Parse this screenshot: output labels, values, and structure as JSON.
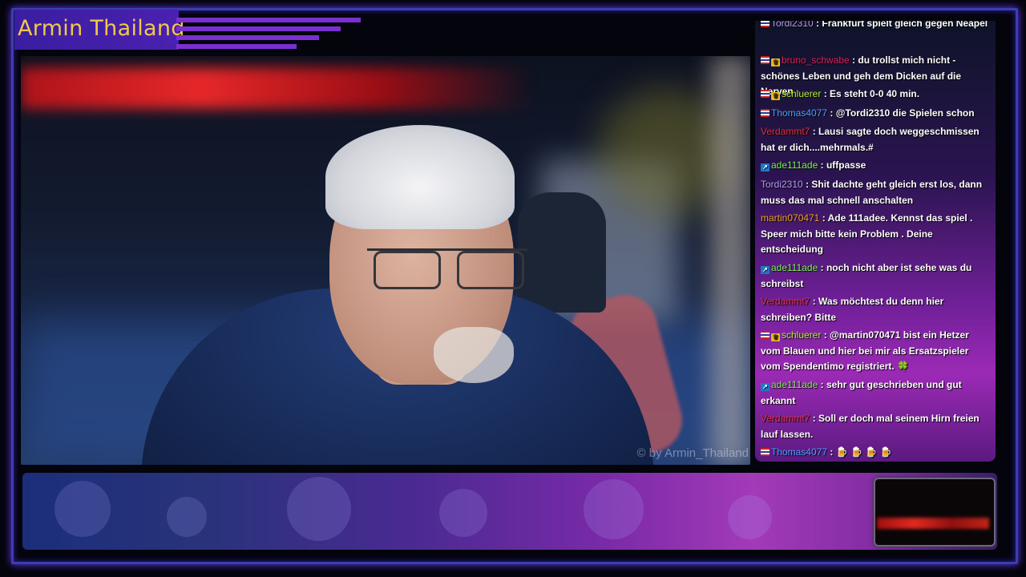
{
  "stream": {
    "title": "Armin Thailand",
    "watermark": "© by Armin_Thailand"
  },
  "chat": {
    "messages": [
      {
        "user": "Tordi2310",
        "color": "#b69cf0",
        "badges": [
          "flag"
        ],
        "text": ": Frankfurt spielt gleich gegen Neapel"
      },
      {
        "user": "bruno_schwabe",
        "color": "#e0205a",
        "badges": [
          "flag",
          "crown"
        ],
        "text": ": du trollst mich nicht - schönes Leben und geh dem Dicken auf die Nerven"
      },
      {
        "user": "schluerer",
        "color": "#b6f036",
        "badges": [
          "flag",
          "crown"
        ],
        "text": ": Es steht 0-0 40 min."
      },
      {
        "user": "Thomas4077",
        "color": "#4aa0ff",
        "badges": [
          "flag"
        ],
        "text": ": @Tordi2310 die Spielen schon"
      },
      {
        "user": "Verdammt7",
        "color": "#e0303a",
        "badges": [],
        "text": ": Lausi sagte doch weggeschmissen hat er dich....mehrmals.#"
      },
      {
        "user": "ade111ade",
        "color": "#7cf05a",
        "badges": [
          "prime"
        ],
        "text": ": uffpasse"
      },
      {
        "user": "Tordi2310",
        "color": "#b69cf0",
        "badges": [],
        "text": ": Shit dachte geht gleich erst los, dann muss das mal schnell anschalten"
      },
      {
        "user": "martin070471",
        "color": "#f0a020",
        "badges": [],
        "text": ": Ade 111adee. Kennst das spiel . Speer mich bitte kein Problem . Deine entscheidung"
      },
      {
        "user": "ade111ade",
        "color": "#7cf05a",
        "badges": [
          "prime"
        ],
        "text": ": noch nicht aber ist sehe was du schreibst"
      },
      {
        "user": "Verdammt7",
        "color": "#e0303a",
        "badges": [],
        "text": ": Was möchtest du denn hier schreiben? Bitte"
      },
      {
        "user": "schluerer",
        "color": "#b6f036",
        "badges": [
          "flag",
          "crown"
        ],
        "text": ": @martin070471 bist ein Hetzer vom Blauen und hier bei mir als Ersatzspieler vom Spendentimo registriert. 🍀"
      },
      {
        "user": "ade111ade",
        "color": "#7cf05a",
        "badges": [
          "prime"
        ],
        "text": ": sehr gut geschrieben und gut erkannt"
      },
      {
        "user": "Verdammt7",
        "color": "#e0303a",
        "badges": [],
        "text": ": Soll er doch mal seinem Hirn freien lauf lassen."
      },
      {
        "user": "Thomas4077",
        "color": "#4aa0ff",
        "badges": [
          "flag"
        ],
        "text": ": 🍺 🍺 🍺 🍺"
      }
    ]
  },
  "colors": {
    "accent": "#f2c84a",
    "frame": "#3a3fb0"
  }
}
